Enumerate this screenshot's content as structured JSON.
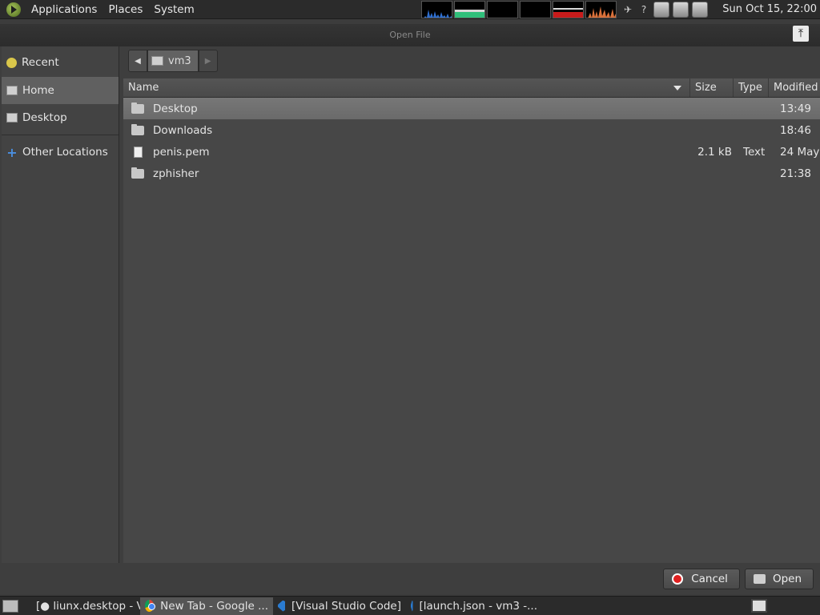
{
  "top_panel": {
    "menus": [
      "Applications",
      "Places",
      "System"
    ],
    "clock": "Sun Oct 15, 22:00"
  },
  "dialog": {
    "title": "Open File",
    "path": {
      "current": "vm3"
    },
    "sidebar": [
      {
        "label": "Recent",
        "icon": "clock-icon"
      },
      {
        "label": "Home",
        "icon": "home-folder-icon",
        "active": true
      },
      {
        "label": "Desktop",
        "icon": "desktop-folder-icon"
      },
      {
        "label": "Other Locations",
        "icon": "plus-icon"
      }
    ],
    "columns": {
      "name": "Name",
      "size": "Size",
      "type": "Type",
      "modified": "Modified"
    },
    "files": [
      {
        "name": "Desktop",
        "size": "",
        "type": "",
        "modified": "13:49",
        "kind": "folder",
        "selected": true
      },
      {
        "name": "Downloads",
        "size": "",
        "type": "",
        "modified": "18:46",
        "kind": "folder"
      },
      {
        "name": "penis.pem",
        "size": "2.1 kB",
        "type": "Text",
        "modified": "24 May",
        "kind": "file"
      },
      {
        "name": "zphisher",
        "size": "",
        "type": "",
        "modified": "21:38",
        "kind": "folder"
      }
    ],
    "buttons": {
      "cancel": "Cancel",
      "open": "Open"
    }
  },
  "taskbar": {
    "tasks": [
      {
        "label": "[● liunx.desktop - Vi...",
        "icon": "vscode-icon"
      },
      {
        "label": "New Tab - Google ...",
        "icon": "chrome-icon",
        "active": true
      },
      {
        "label": "[Visual Studio Code]",
        "icon": "vscode-icon"
      },
      {
        "label": "[launch.json - vm3 -...",
        "icon": "vscode-icon"
      }
    ]
  },
  "colors": {
    "accent_red": "#e02020",
    "panel": "#2b2b2b",
    "selection": "#6f6f6f"
  }
}
